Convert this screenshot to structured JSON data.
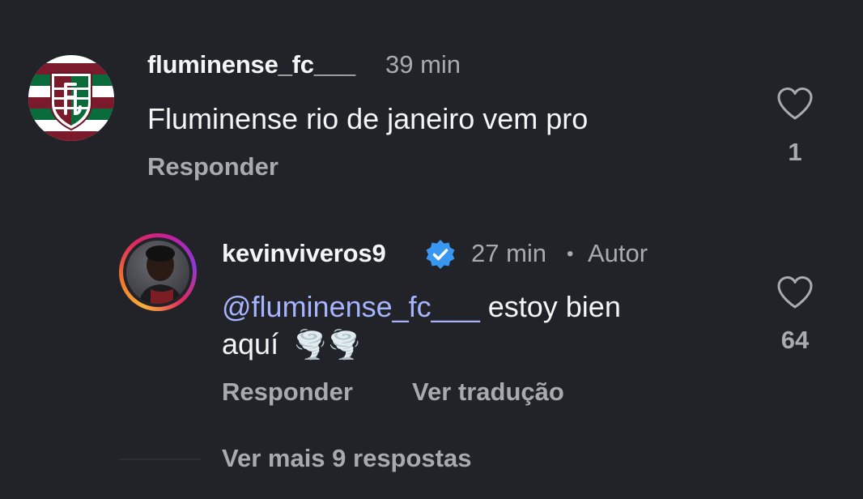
{
  "comments": [
    {
      "username": "fluminense_fc___",
      "time": "39 min",
      "text": "Fluminense rio de janeiro vem pro",
      "reply_label": "Responder",
      "likes": "1",
      "avatar_icon": "fluminense-crest-icon"
    }
  ],
  "reply": {
    "username": "kevinviveros9",
    "verified": true,
    "time": "27 min",
    "separator": "•",
    "author_badge": "Autor",
    "mention": "@fluminense_fc___",
    "text_line1": " estoy bien",
    "text_line2": "aquí",
    "emoji": "🌪️🌪️",
    "reply_label": "Responder",
    "translate_label": "Ver tradução",
    "likes": "64"
  },
  "more_replies": "Ver mais 9 respostas",
  "colors": {
    "background": "#212328",
    "text": "#f5f5f5",
    "muted": "#a8aab0",
    "mention": "#a5b4fc",
    "verified": "#3897f0"
  }
}
